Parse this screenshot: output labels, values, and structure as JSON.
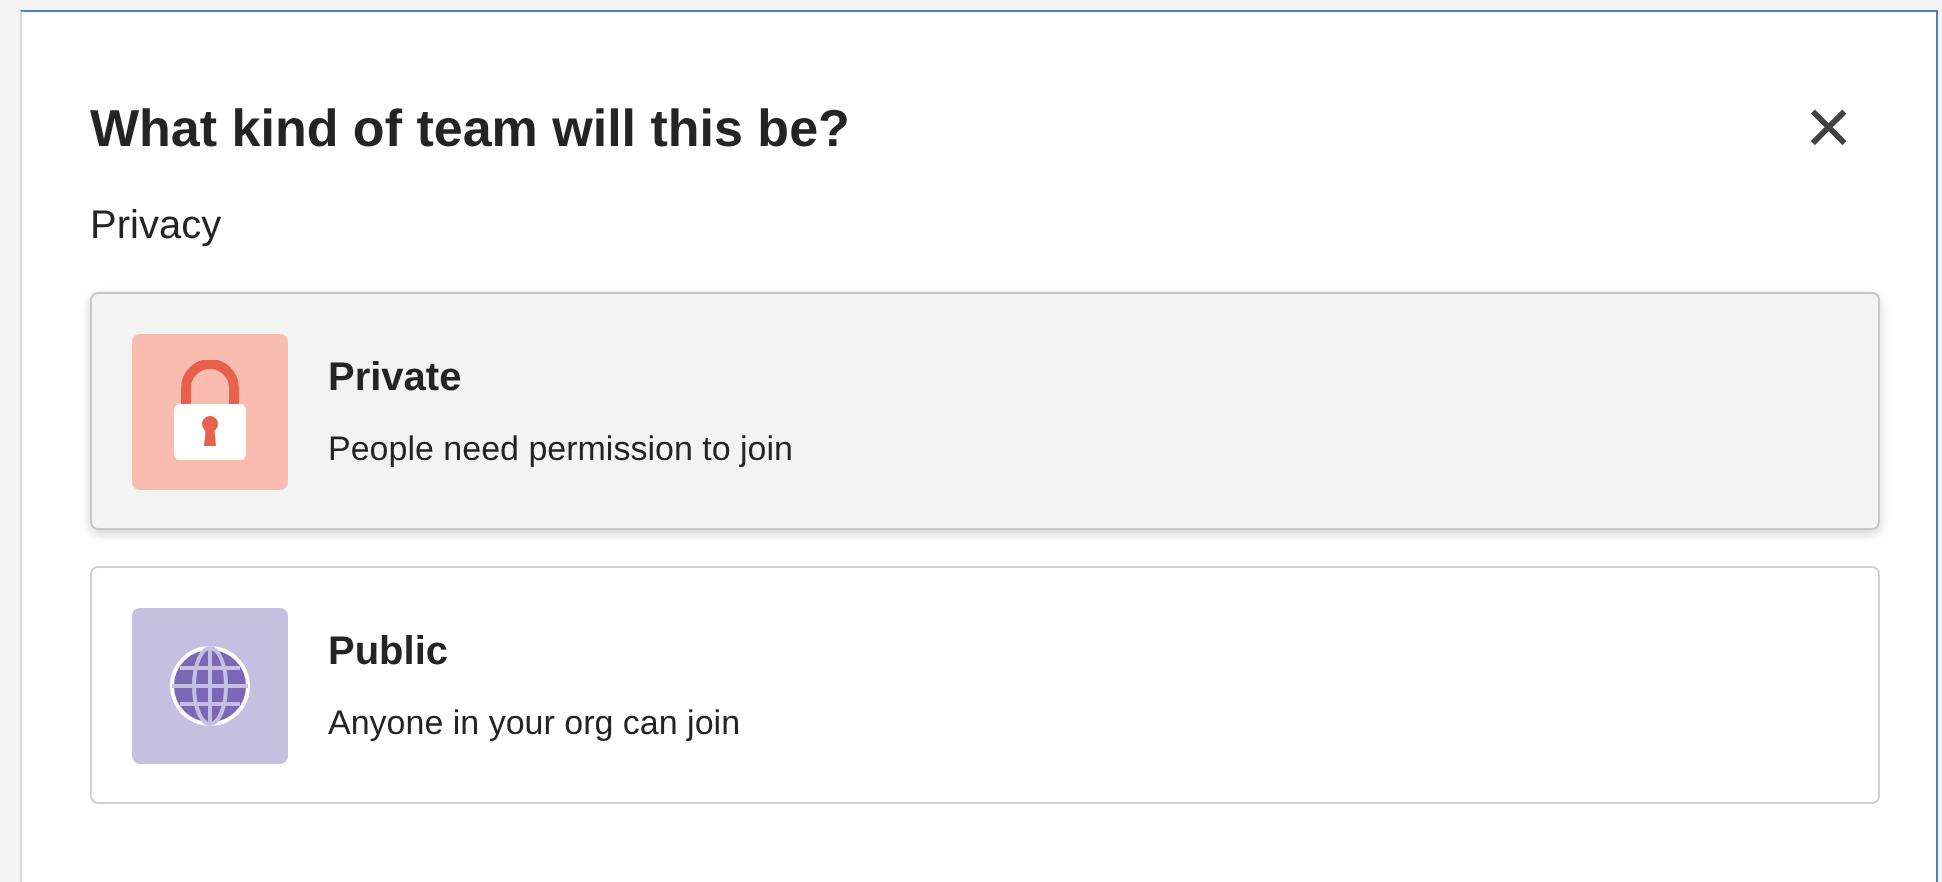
{
  "dialog": {
    "title": "What kind of team will this be?",
    "close": "×"
  },
  "section_label": "Privacy",
  "options": [
    {
      "kind": "lock",
      "title": "Private",
      "description": "People need permission to join",
      "selected": true
    },
    {
      "kind": "globe",
      "title": "Public",
      "description": "Anyone in your org can join",
      "selected": false
    }
  ]
}
